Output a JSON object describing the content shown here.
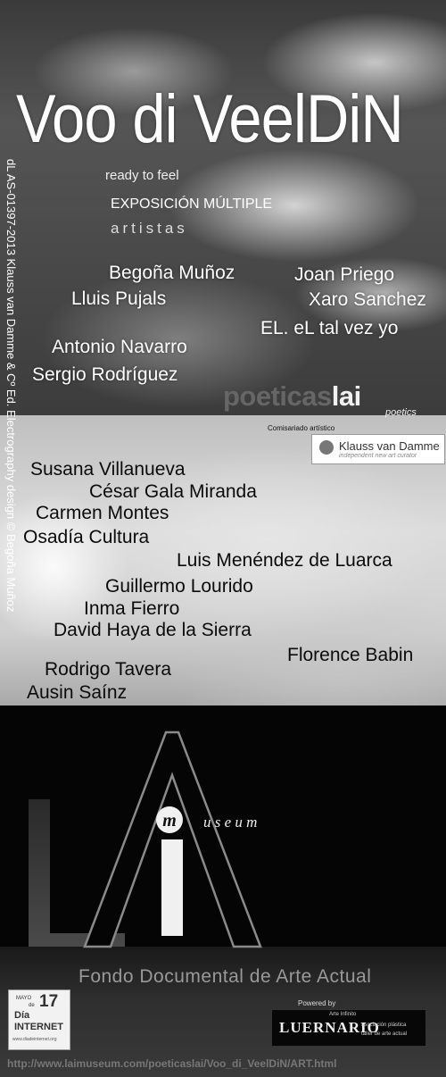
{
  "title": "Voo di VeelDiN",
  "tagline": "ready to feel",
  "subtitle": "EXPOSICIÓN MÚLTIPLE",
  "artistas_label": "artistas",
  "vertical_credit": "dL AS-01397-2013   Klauss van Damme & Cº Ed. Electrography design © Begoña Muñoz",
  "artists_top": [
    "Begoña Muñoz",
    "Joan Priego",
    "Lluis Pujals",
    "Xaro Sanchez",
    "EL. eL tal vez yo",
    "Antonio Navarro",
    "Sergio Rodríguez"
  ],
  "poeticas": {
    "part1": "poeticas",
    "part2": "lai",
    "sub": "poetics"
  },
  "comisariado": "Comisariado artístico",
  "klauss": {
    "name": "Klauss van Damme",
    "sub": "independent new art curator"
  },
  "artists_mid": [
    "Susana Villanueva",
    "César Gala Miranda",
    "Carmen Montes",
    "Osadía Cultura",
    "Luis Menéndez de Luarca",
    "Guillermo Lourido",
    "Inma Fierro",
    "David Haya de la Sierra",
    "Florence Babin",
    "Rodrigo Tavera",
    "Ausin Saínz"
  ],
  "museum_logo": {
    "letters": "LAI",
    "m": "m",
    "word": "u s e u m"
  },
  "fondo": "Fondo Documental de Arte Actual",
  "dia_badge": {
    "mayo": "MAYO",
    "de": "de",
    "num": "17",
    "dia": "Día",
    "internet": "INTERNET",
    "url": "www.diadeinternet.org"
  },
  "powered_by": "Powered by",
  "luernario": {
    "name": "LUERNARIO",
    "top": "Arte Infinito",
    "sub1": "asociación plástica",
    "sub2": "taller de arte actual"
  },
  "url": "http://www.laimuseum.com/poeticaslai/Voo_di_VeelDiN/ART.html",
  "colors": {
    "background_bottom": "#050505",
    "text_light": "#ffffff",
    "text_dark": "#0b0b0b"
  }
}
